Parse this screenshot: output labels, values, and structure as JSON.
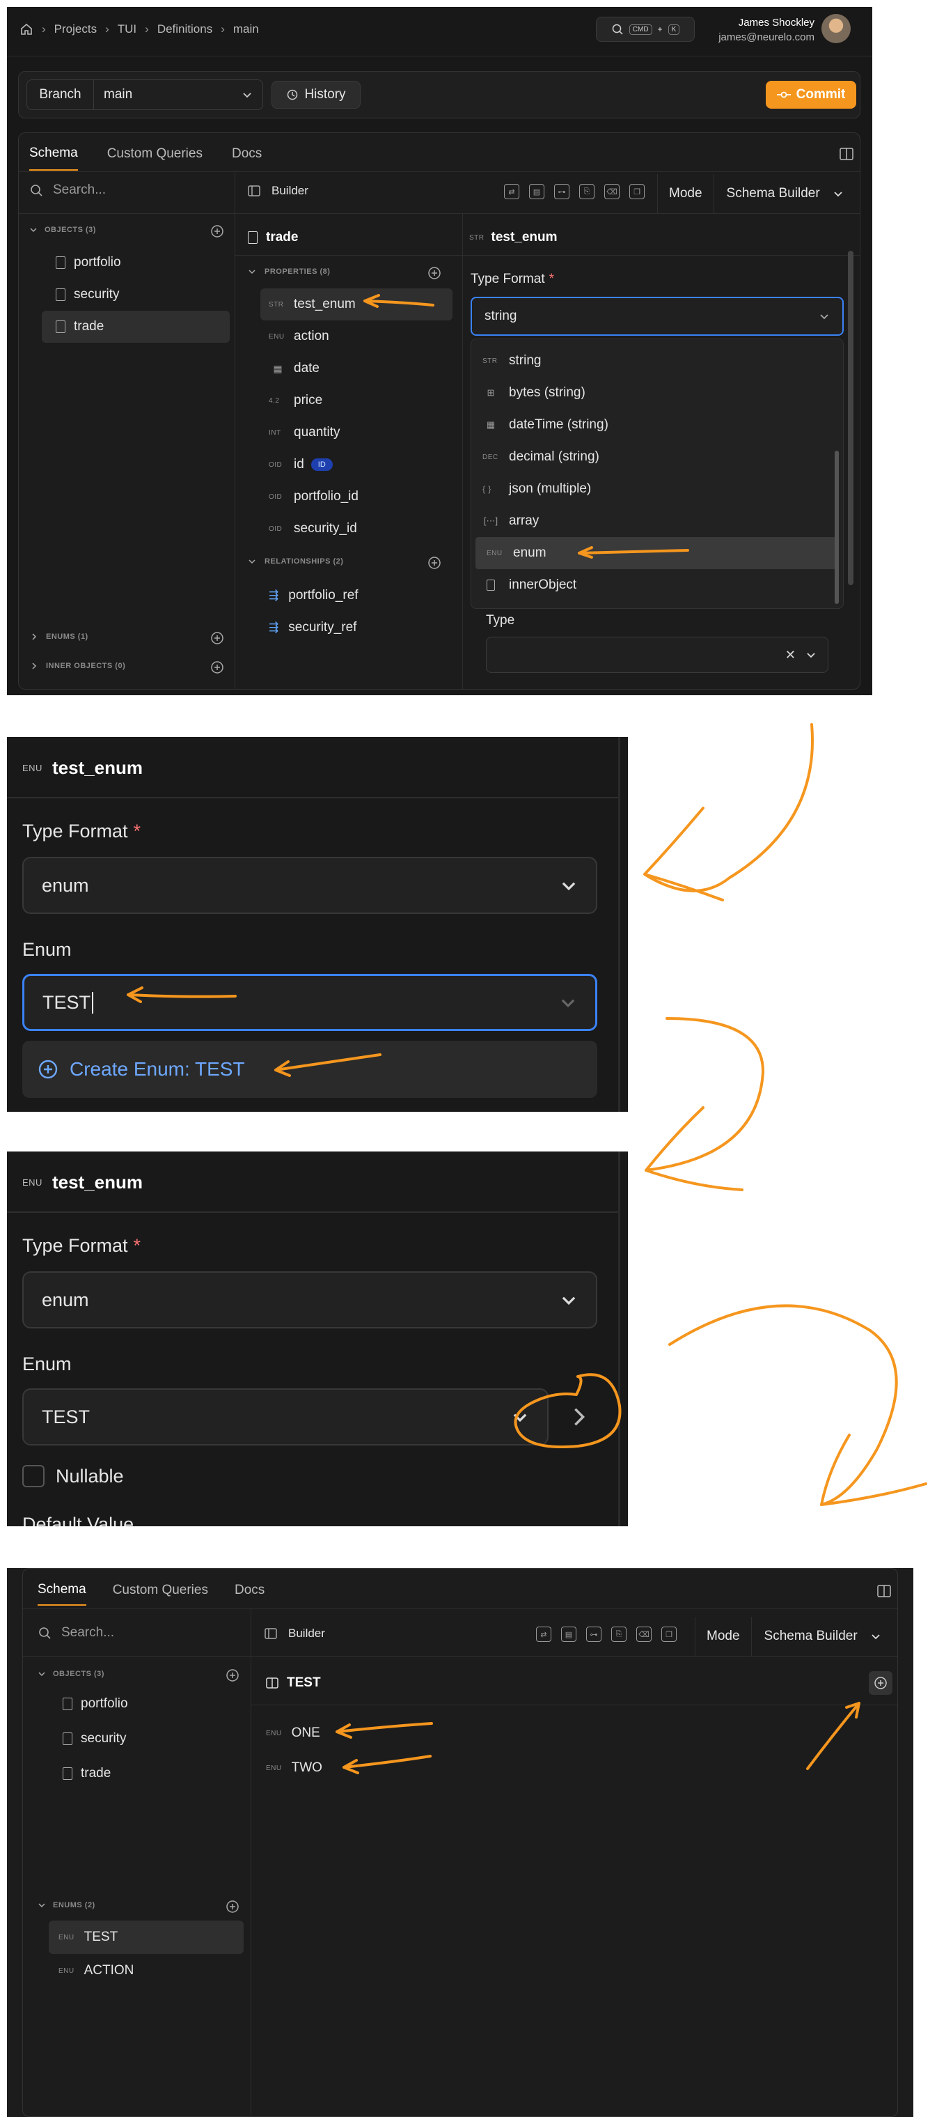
{
  "panel1": {
    "breadcrumb": [
      "Projects",
      "TUI",
      "Definitions",
      "main"
    ],
    "search_kbd": [
      "CMD",
      "+",
      "K"
    ],
    "user": {
      "name": "James Shockley",
      "email": "james@neurelo.com"
    },
    "branch_label": "Branch",
    "branch_value": "main",
    "history_label": "History",
    "commit_label": "Commit",
    "tabs": [
      "Schema",
      "Custom Queries",
      "Docs"
    ],
    "search_placeholder": "Search...",
    "builder_label": "Builder",
    "mode_label": "Mode",
    "mode_value": "Schema Builder",
    "objects_header": "OBJECTS (3)",
    "objects": [
      "portfolio",
      "security",
      "trade"
    ],
    "enums_header": "ENUMS (1)",
    "inner_header": "INNER OBJECTS (0)",
    "entity_title": "trade",
    "properties_header": "PROPERTIES (8)",
    "properties": [
      {
        "badge": "STR",
        "name": "test_enum"
      },
      {
        "badge": "ENU",
        "name": "action"
      },
      {
        "badge": "",
        "name": "date"
      },
      {
        "badge": "4.2",
        "name": "price"
      },
      {
        "badge": "INT",
        "name": "quantity"
      },
      {
        "badge": "OID",
        "name": "id",
        "tag": "ID"
      },
      {
        "badge": "OID",
        "name": "portfolio_id"
      },
      {
        "badge": "OID",
        "name": "security_id"
      }
    ],
    "relationships_header": "RELATIONSHIPS (2)",
    "relationships": [
      "portfolio_ref",
      "security_ref"
    ],
    "detail_badge": "STR",
    "detail_title": "test_enum",
    "type_format_label": "Type Format",
    "required_mark": "*",
    "type_format_value": "string",
    "dropdown_options": [
      {
        "badge": "STR",
        "label": "string"
      },
      {
        "badge": "",
        "label": "bytes (string)"
      },
      {
        "badge": "",
        "label": "dateTime (string)"
      },
      {
        "badge": "DEC",
        "label": "decimal (string)"
      },
      {
        "badge": "{ }",
        "label": "json (multiple)"
      },
      {
        "badge": "",
        "label": "array"
      },
      {
        "badge": "ENU",
        "label": "enum"
      },
      {
        "badge": "",
        "label": "innerObject"
      }
    ],
    "type_label": "Type"
  },
  "panel2": {
    "badge": "ENU",
    "title": "test_enum",
    "type_format_label": "Type Format",
    "required_mark": "*",
    "type_format_value": "enum",
    "enum_label": "Enum",
    "enum_input": "TEST",
    "create_option": "Create Enum: TEST"
  },
  "panel3": {
    "badge": "ENU",
    "title": "test_enum",
    "type_format_label": "Type Format",
    "required_mark": "*",
    "type_format_value": "enum",
    "enum_label": "Enum",
    "enum_value": "TEST",
    "nullable_label": "Nullable",
    "cut_label": "Default Value"
  },
  "panel4": {
    "tabs": [
      "Schema",
      "Custom Queries",
      "Docs"
    ],
    "search_placeholder": "Search...",
    "builder_label": "Builder",
    "mode_label": "Mode",
    "mode_value": "Schema Builder",
    "objects_header": "OBJECTS (3)",
    "objects": [
      "portfolio",
      "security",
      "trade"
    ],
    "enums_header": "ENUMS (2)",
    "enums": [
      "TEST",
      "ACTION"
    ],
    "enum_badge": "ENU",
    "enum_title": "TEST",
    "values": [
      "ONE",
      "TWO"
    ]
  },
  "colors": {
    "accent": "#f5961e",
    "panel_bg": "#1b1b1b",
    "focus_blue": "#3b82f6"
  }
}
